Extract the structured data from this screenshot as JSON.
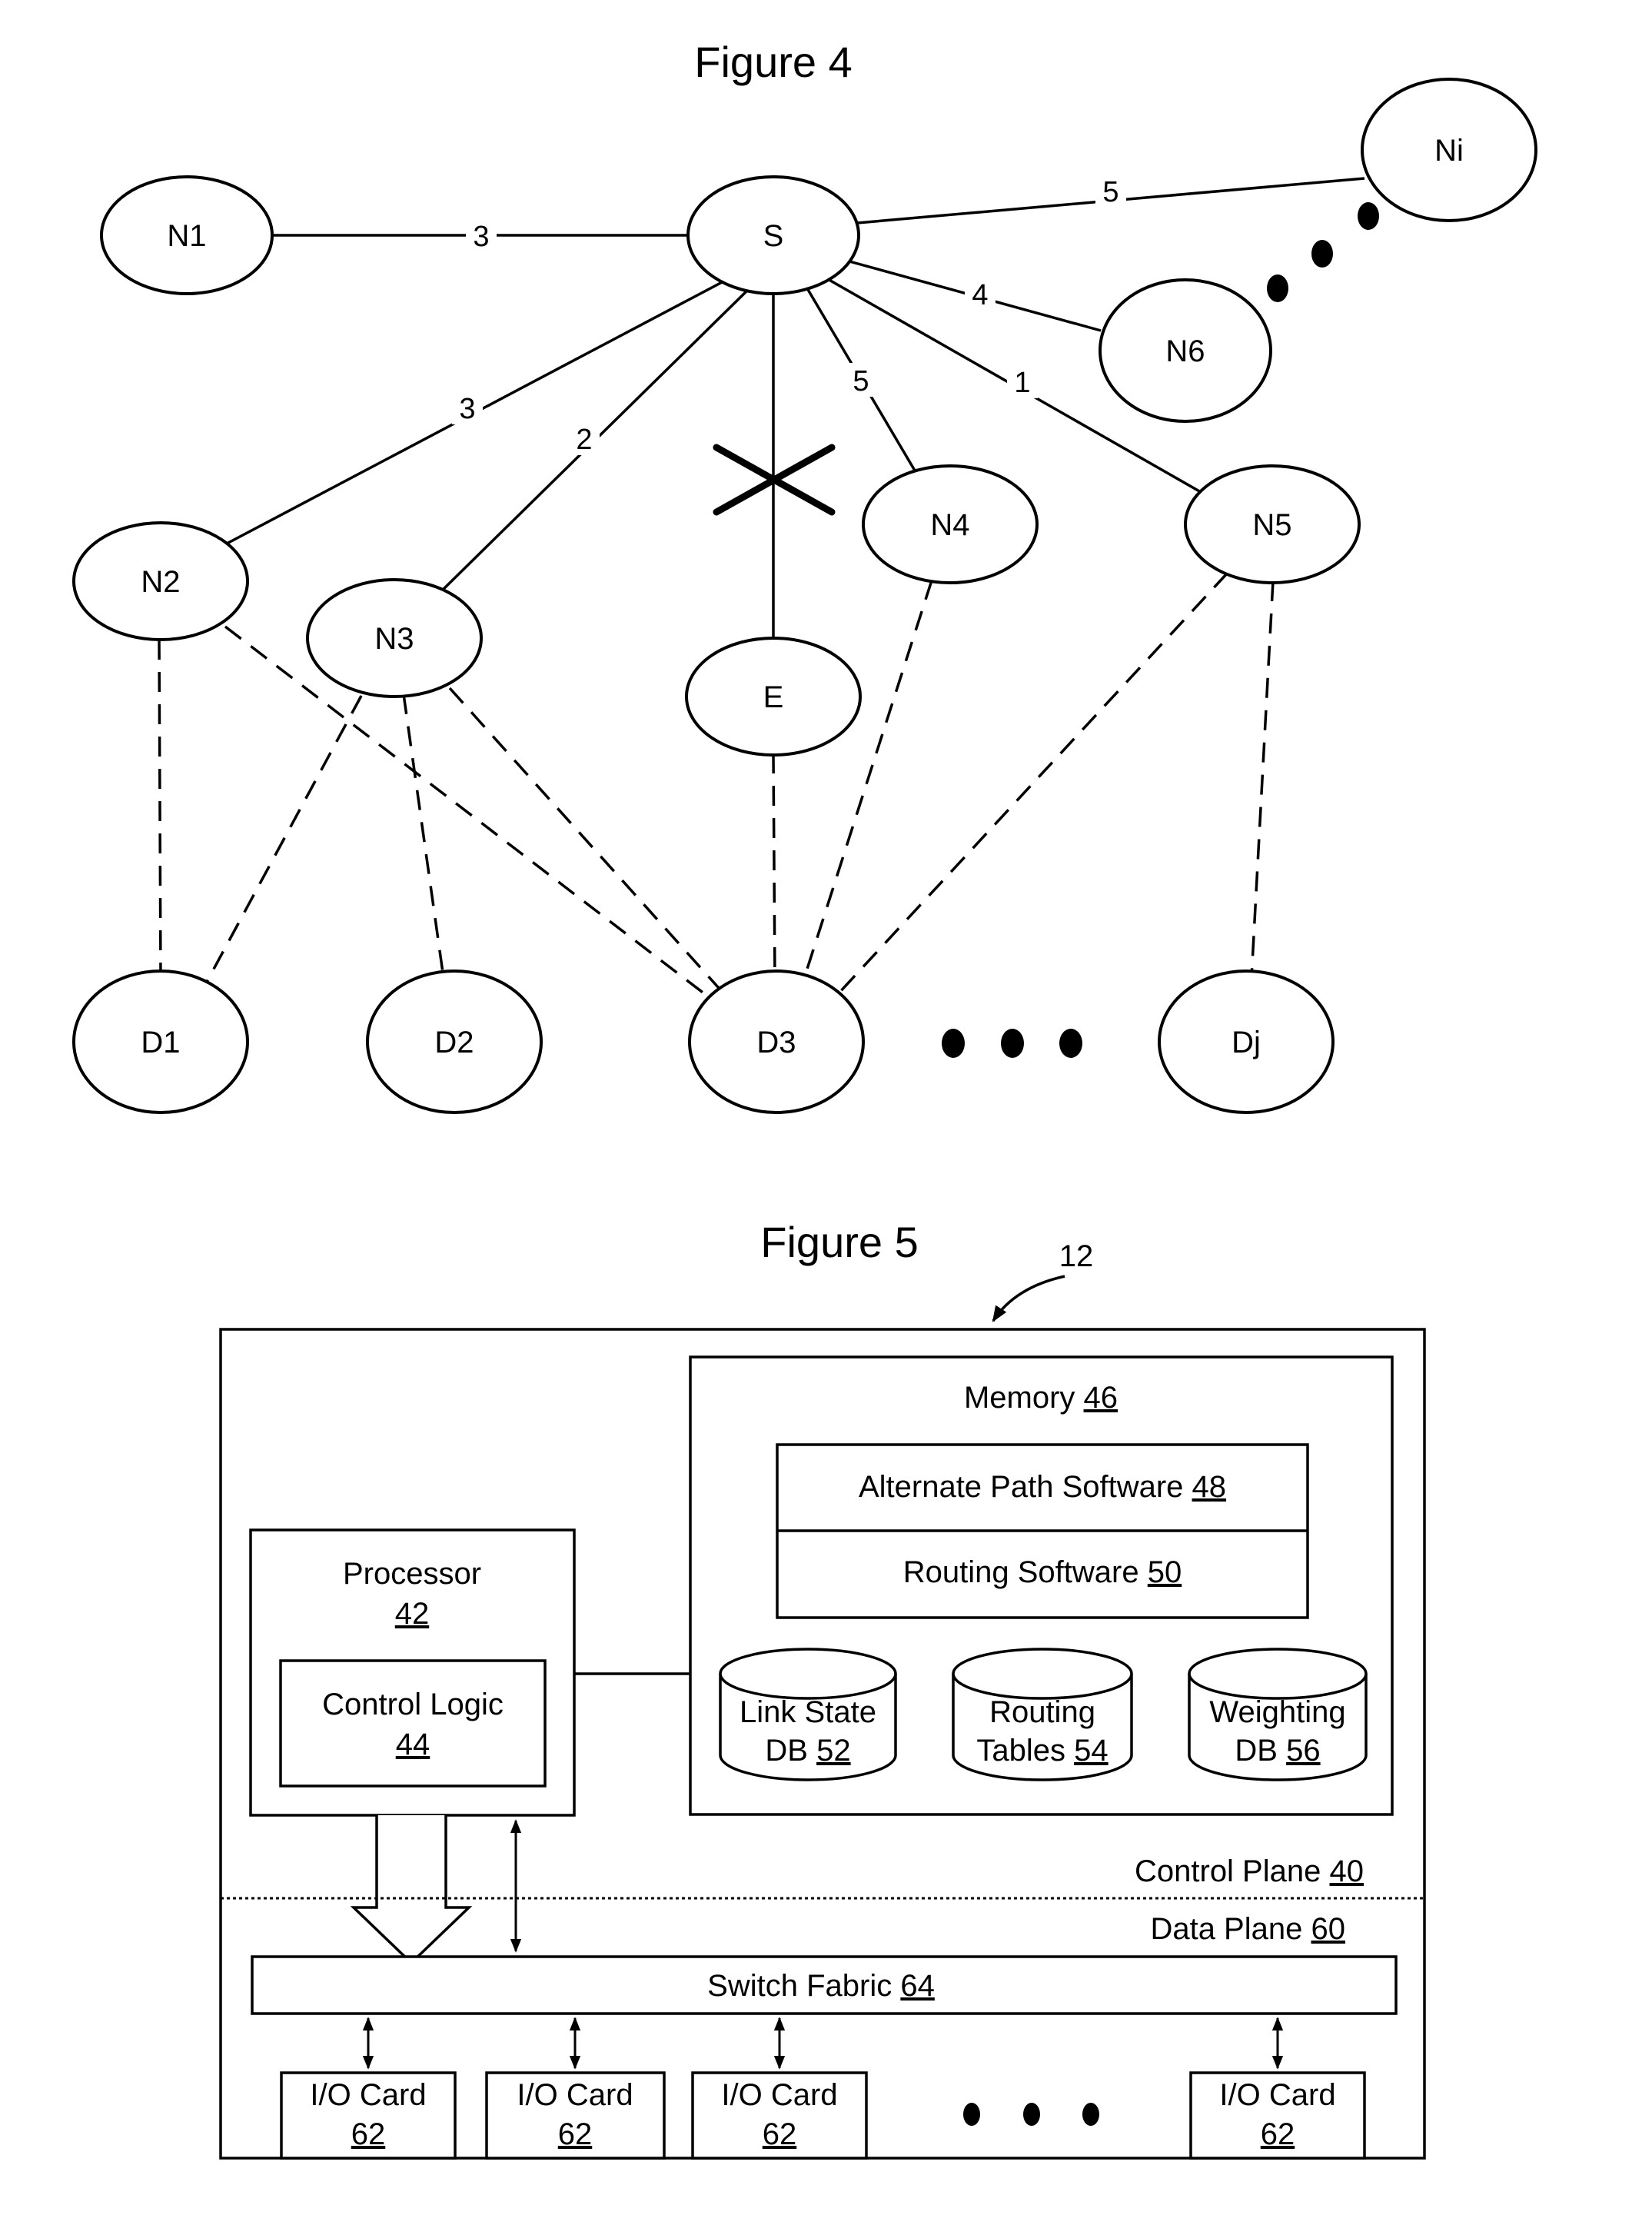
{
  "figure4": {
    "title": "Figure 4",
    "nodes": {
      "S": "S",
      "N1": "N1",
      "Ni": "Ni",
      "N6": "N6",
      "N2": "N2",
      "N3": "N3",
      "E": "E",
      "N4": "N4",
      "N5": "N5",
      "D1": "D1",
      "D2": "D2",
      "D3": "D3",
      "Dj": "Dj"
    },
    "links": [
      {
        "from": "S",
        "to": "N1",
        "weight": "3",
        "style": "solid"
      },
      {
        "from": "S",
        "to": "Ni",
        "weight": "5",
        "style": "solid"
      },
      {
        "from": "S",
        "to": "N6",
        "weight": "4",
        "style": "solid"
      },
      {
        "from": "S",
        "to": "N2",
        "weight": "3",
        "style": "solid"
      },
      {
        "from": "S",
        "to": "N3",
        "weight": "2",
        "style": "solid"
      },
      {
        "from": "S",
        "to": "E",
        "weight": "",
        "style": "solid",
        "failed": true
      },
      {
        "from": "S",
        "to": "N4",
        "weight": "5",
        "style": "solid"
      },
      {
        "from": "S",
        "to": "N5",
        "weight": "1",
        "style": "solid"
      },
      {
        "from": "N2",
        "to": "D1",
        "style": "dashed"
      },
      {
        "from": "N2",
        "to": "D3",
        "style": "dashed"
      },
      {
        "from": "N3",
        "to": "D1",
        "style": "dashed"
      },
      {
        "from": "N3",
        "to": "D2",
        "style": "dashed"
      },
      {
        "from": "N3",
        "to": "D3",
        "style": "dashed"
      },
      {
        "from": "E",
        "to": "D3",
        "style": "dashed"
      },
      {
        "from": "N4",
        "to": "D3",
        "style": "dashed"
      },
      {
        "from": "N5",
        "to": "D3",
        "style": "dashed"
      },
      {
        "from": "N5",
        "to": "Dj",
        "style": "dashed"
      }
    ],
    "failed_link_marker": "X",
    "ellipsis": "• • •"
  },
  "figure5": {
    "title": "Figure 5",
    "ref_label": "12",
    "memory": {
      "label": "Memory",
      "ref": "46"
    },
    "alt_path_software": {
      "label": "Alternate Path Software",
      "ref": "48"
    },
    "routing_software": {
      "label": "Routing Software",
      "ref": "50"
    },
    "link_state_db": {
      "line1": "Link State",
      "line2": "DB",
      "ref": "52"
    },
    "routing_tables": {
      "line1": "Routing",
      "line2": "Tables",
      "ref": "54"
    },
    "weighting_db": {
      "line1": "Weighting",
      "line2": "DB",
      "ref": "56"
    },
    "processor": {
      "label": "Processor",
      "ref": "42"
    },
    "control_logic": {
      "label": "Control Logic",
      "ref": "44"
    },
    "control_plane": {
      "label": "Control Plane",
      "ref": "40"
    },
    "data_plane": {
      "label": "Data Plane",
      "ref": "60"
    },
    "switch_fabric": {
      "label": "Switch Fabric",
      "ref": "64"
    },
    "io_cards": [
      {
        "label": "I/O Card",
        "ref": "62"
      },
      {
        "label": "I/O Card",
        "ref": "62"
      },
      {
        "label": "I/O Card",
        "ref": "62"
      },
      {
        "label": "I/O Card",
        "ref": "62"
      }
    ]
  }
}
